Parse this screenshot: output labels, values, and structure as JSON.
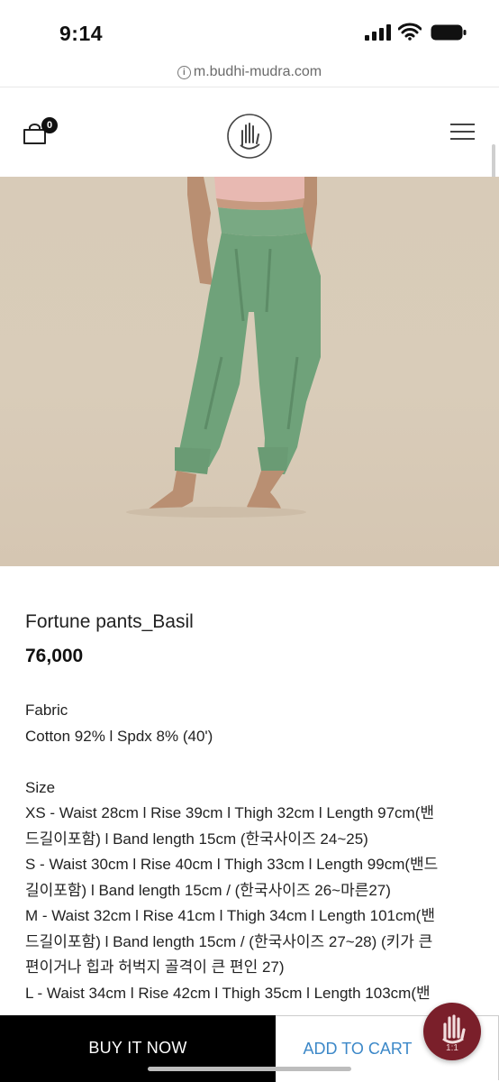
{
  "status": {
    "time": "9:14"
  },
  "browser": {
    "url": "m.budhi-mudra.com"
  },
  "header": {
    "cart_count": "0"
  },
  "product": {
    "name": "Fortune pants_Basil",
    "price": "76,000",
    "fabric_label": "Fabric",
    "fabric_value": "Cotton 92% l Spdx 8% (40')",
    "size_label": "Size",
    "size_lines": [
      "XS - Waist 28cm l Rise 39cm l Thigh 32cm l Length 97cm(밴",
      "드길이포함) l Band length 15cm (한국사이즈 24~25)",
      "S - Waist 30cm l Rise 40cm l Thigh 33cm l Length 99cm(밴드",
      "길이포함) l Band length 15cm / (한국사이즈 26~마른27)",
      "M - Waist 32cm l Rise 41cm l Thigh 34cm l Length 101cm(밴",
      "드길이포함) l Band length 15cm / (한국사이즈 27~28) (키가 큰",
      "편이거나 힙과 허벅지 골격이 큰 편인 27)",
      "L - Waist 34cm l Rise 42cm l Thigh 35cm l Length 103cm(밴"
    ]
  },
  "actions": {
    "buy_now": "BUY IT NOW",
    "add_to_cart": "ADD TO CART"
  },
  "chat": {
    "label": "1:1"
  }
}
